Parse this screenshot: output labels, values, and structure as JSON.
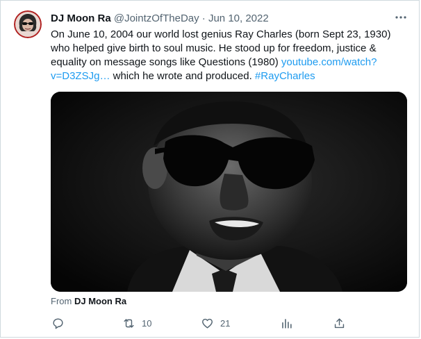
{
  "author": {
    "display_name": "DJ Moon Ra",
    "handle": "@JointzOfTheDay",
    "separator": "·",
    "date": "Jun 10, 2022"
  },
  "tweet": {
    "text_before_link": "On June 10, 2004 our world lost genius Ray Charles (born Sept 23, 1930) who helped give birth to soul music. He stood up for freedom, justice & equality on message songs like Questions (1980) ",
    "link": "youtube.com/watch?v=D3ZSJg…",
    "text_after_link": " which he wrote and produced. ",
    "hashtag": "#RayCharles"
  },
  "media": {
    "alt_subject": "black-and-white photo of man in sunglasses"
  },
  "attribution": {
    "prefix": "From",
    "name": "DJ Moon Ra"
  },
  "actions": {
    "reply_count": "",
    "retweet_count": "10",
    "like_count": "21",
    "views_count": ""
  },
  "colors": {
    "link": "#1d9bf0",
    "muted": "#536471",
    "text": "#0f1419"
  }
}
